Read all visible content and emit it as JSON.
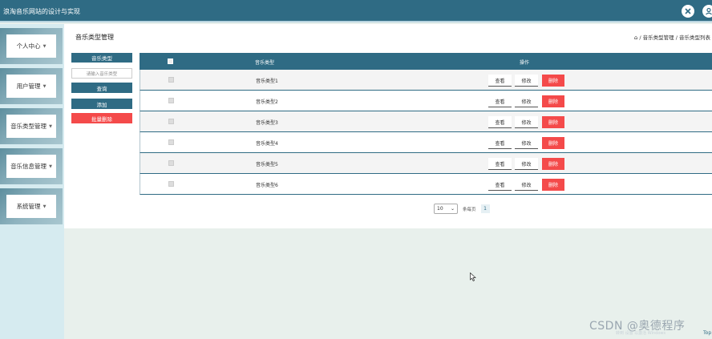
{
  "header": {
    "title": "浪淘音乐网站的设计与实现",
    "icons": [
      "switch-icon",
      "user-icon"
    ]
  },
  "sidebar": {
    "items": [
      {
        "label": "个人中心"
      },
      {
        "label": "用户管理"
      },
      {
        "label": "音乐类型管理"
      },
      {
        "label": "音乐信息管理"
      },
      {
        "label": "系统管理"
      }
    ]
  },
  "page": {
    "title": "音乐类型管理",
    "breadcrumb": "/ 音乐类型管理 / 音乐类型列表"
  },
  "filter": {
    "label": "音乐类型",
    "placeholder": "请输入音乐类型",
    "query_label": "查询",
    "add_label": "添加",
    "bulk_delete_label": "批量删除"
  },
  "table": {
    "columns": [
      "音乐类型",
      "操作"
    ],
    "rows": [
      {
        "name": "音乐类型1"
      },
      {
        "name": "音乐类型2"
      },
      {
        "name": "音乐类型3"
      },
      {
        "name": "音乐类型4"
      },
      {
        "name": "音乐类型5"
      },
      {
        "name": "音乐类型6"
      }
    ],
    "actions": {
      "view": "查看",
      "edit": "修改",
      "delete": "删除"
    }
  },
  "pagination": {
    "page_size": "10",
    "per_page_label": "条每页",
    "current_page": "1"
  },
  "overlay": {
    "watermark": "CSDN @奥德程序",
    "ghost": "转到 设置 以激活 Windows",
    "top_link": "Top"
  },
  "colors": {
    "primary": "#2f6b84",
    "danger": "#f44a4a",
    "sidebar_bg": "#d6ebf0"
  }
}
